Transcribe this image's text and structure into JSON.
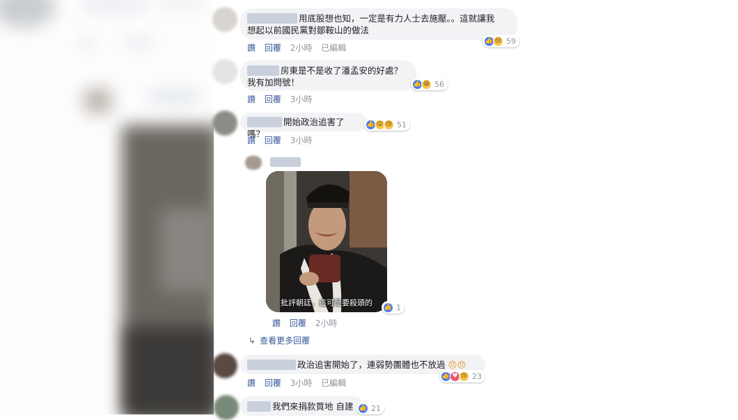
{
  "comments": [
    {
      "text_line1": "用底股想也知，一定是有力人士去施壓。。這就讓我",
      "text_line2": "想起以前國民黨對鄒鞍山的做法",
      "actions": {
        "like": "讚",
        "reply": "回覆",
        "time": "2小時",
        "edited": "已編輯"
      },
      "reaction_count": "59"
    },
    {
      "text_line1": "房東是不是收了潘孟安的好處？",
      "text_line2": "我有加問號！",
      "actions": {
        "like": "讚",
        "reply": "回覆",
        "time": "3小時"
      },
      "reaction_count": "56"
    },
    {
      "text_line1": "開始政治追害了嗎？",
      "actions": {
        "like": "讚",
        "reply": "回覆",
        "time": "3小時"
      },
      "reaction_count": "51"
    },
    {
      "image_caption": "批評朝廷，這可是要殺頭的",
      "actions": {
        "like": "讚",
        "reply": "回覆",
        "time": "2小時"
      },
      "reaction_count": "1"
    },
    {
      "text_line1": "政治追害開始了，連弱勢團體也不放過",
      "actions": {
        "like": "讚",
        "reply": "回覆",
        "time": "3小時",
        "edited": "已編輯"
      },
      "reaction_count": "23"
    },
    {
      "text_line1": "我們來捐款買地 自建",
      "reaction_count": "21"
    }
  ],
  "view_more_replies": "查看更多回覆",
  "colors": {
    "link": "#385898",
    "bubble": "#f2f3f5",
    "like": "#4a7cf7",
    "meta": "#90949c"
  }
}
